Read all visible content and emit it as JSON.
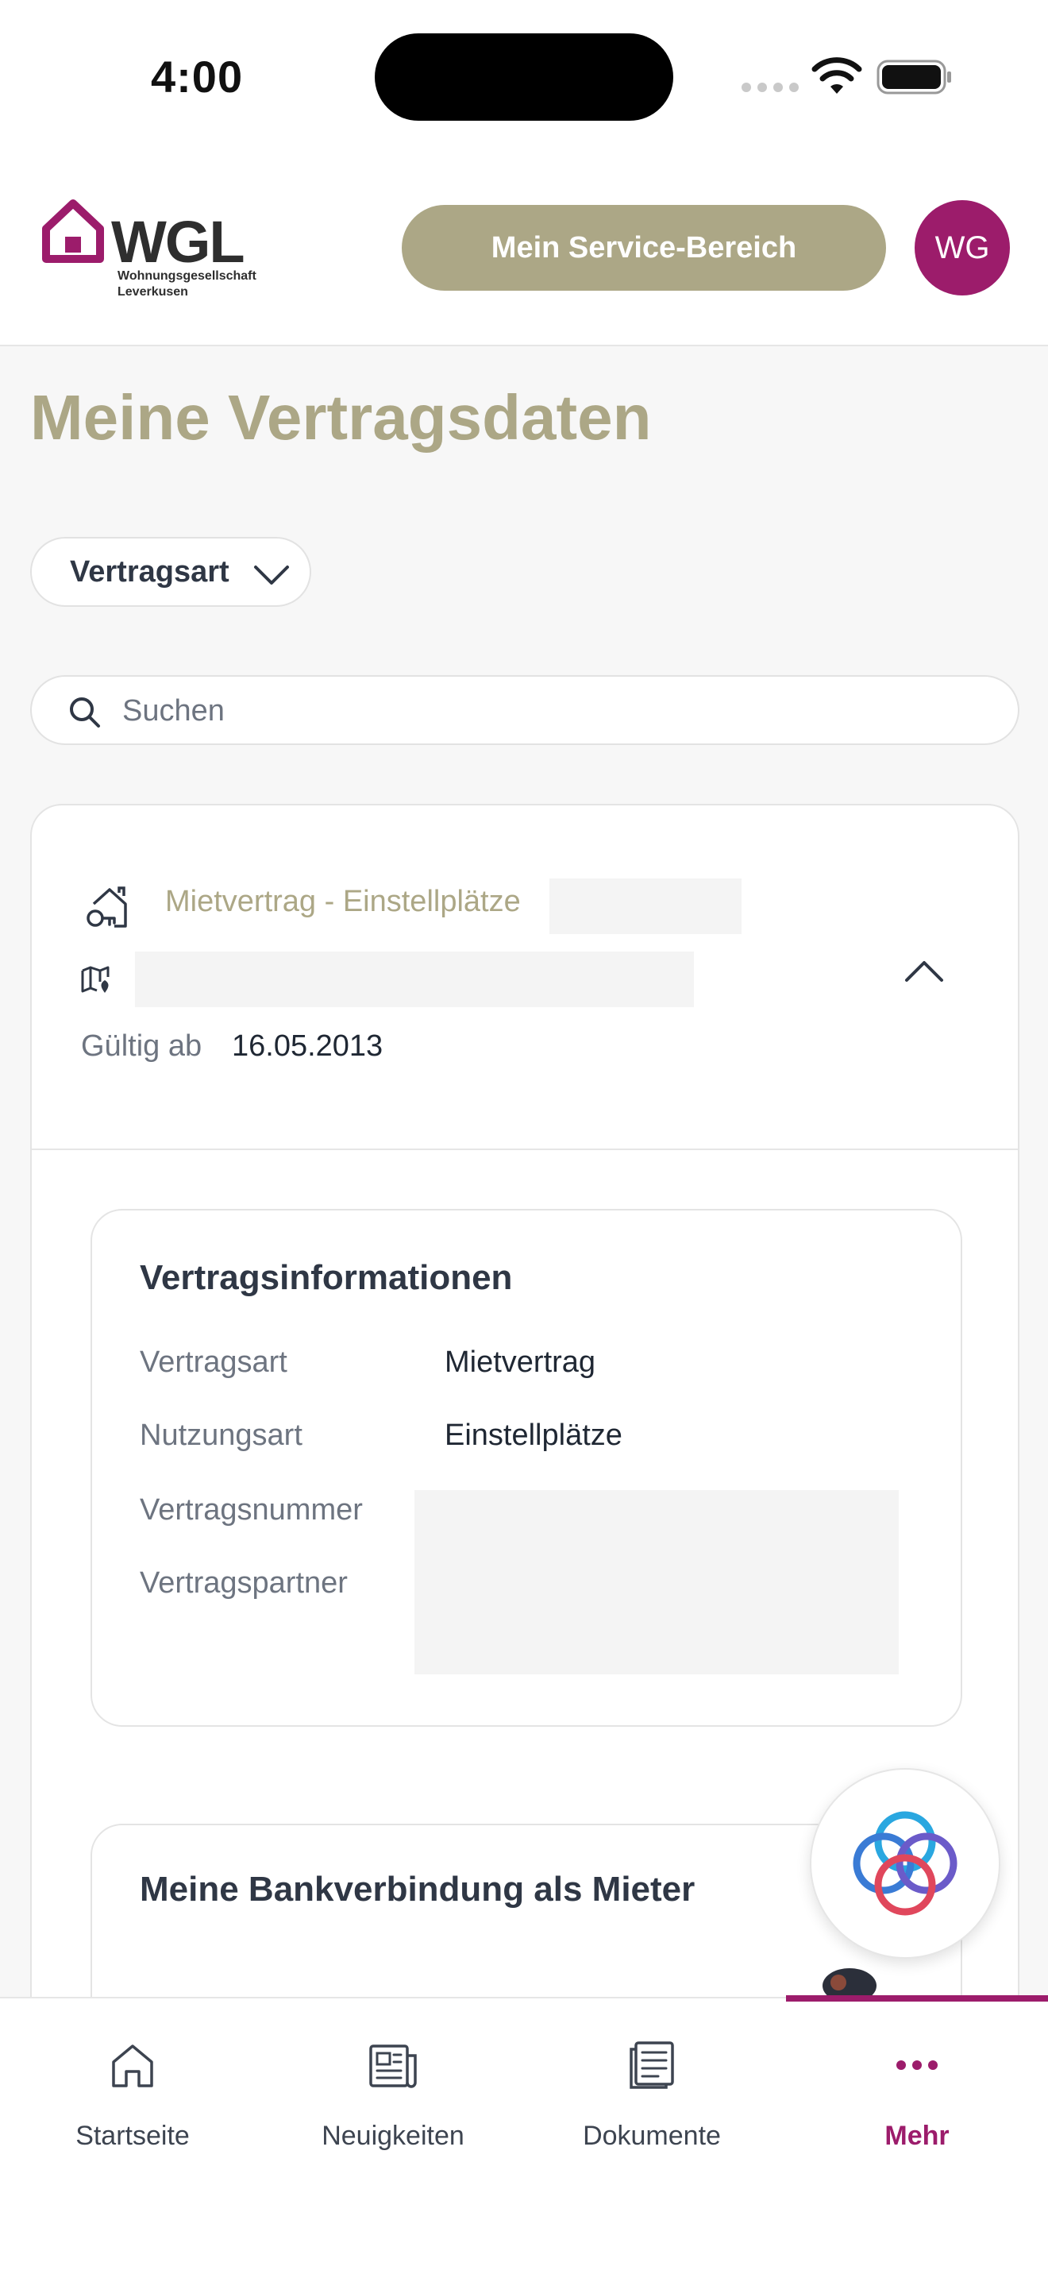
{
  "status_bar": {
    "time": "4:00"
  },
  "header": {
    "logo_text": "WGL",
    "logo_sub_line1": "Wohnungsgesellschaft",
    "logo_sub_line2": "Leverkusen",
    "service_button": "Mein Service-Bereich",
    "avatar_initials": "WG"
  },
  "page": {
    "title": "Meine Vertragsdaten"
  },
  "filter": {
    "label": "Vertragsart"
  },
  "search": {
    "placeholder": "Suchen"
  },
  "contract": {
    "type_label": "Mietvertrag - Einstellplätze",
    "valid_label": "Gültig ab",
    "valid_value": "16.05.2013",
    "info": {
      "title": "Vertragsinformationen",
      "rows": [
        {
          "label": "Vertragsart",
          "value": "Mietvertrag"
        },
        {
          "label": "Nutzungsart",
          "value": "Einstellplätze"
        },
        {
          "label": "Vertragsnummer",
          "value": ""
        },
        {
          "label": "Vertragspartner",
          "value": ""
        }
      ]
    },
    "bank": {
      "title": "Meine Bankverbindung als Mieter"
    }
  },
  "tabbar": {
    "items": [
      {
        "label": "Startseite",
        "icon": "home-icon"
      },
      {
        "label": "Neuigkeiten",
        "icon": "news-icon"
      },
      {
        "label": "Dokumente",
        "icon": "document-icon"
      },
      {
        "label": "Mehr",
        "icon": "more-icon"
      }
    ],
    "active_index": 3
  },
  "colors": {
    "accent": "#9c1c6b",
    "gold": "#aca786",
    "text": "#2f3745"
  }
}
